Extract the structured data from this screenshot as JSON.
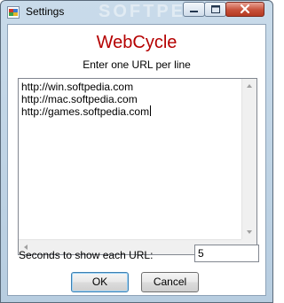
{
  "window": {
    "title": "Settings",
    "watermark": "SOFTPE",
    "controls": [
      "minimize-icon",
      "maximize-icon",
      "close-icon"
    ]
  },
  "dialog": {
    "heading": "WebCycle",
    "heading_color": "#b50000",
    "instruction": "Enter one URL per line",
    "urls": [
      "http://win.softpedia.com",
      "http://mac.softpedia.com",
      "http://games.softpedia.com"
    ],
    "seconds_label": "Seconds to show each URL:",
    "seconds_value": "5"
  },
  "buttons": {
    "ok": "OK",
    "cancel": "Cancel"
  }
}
